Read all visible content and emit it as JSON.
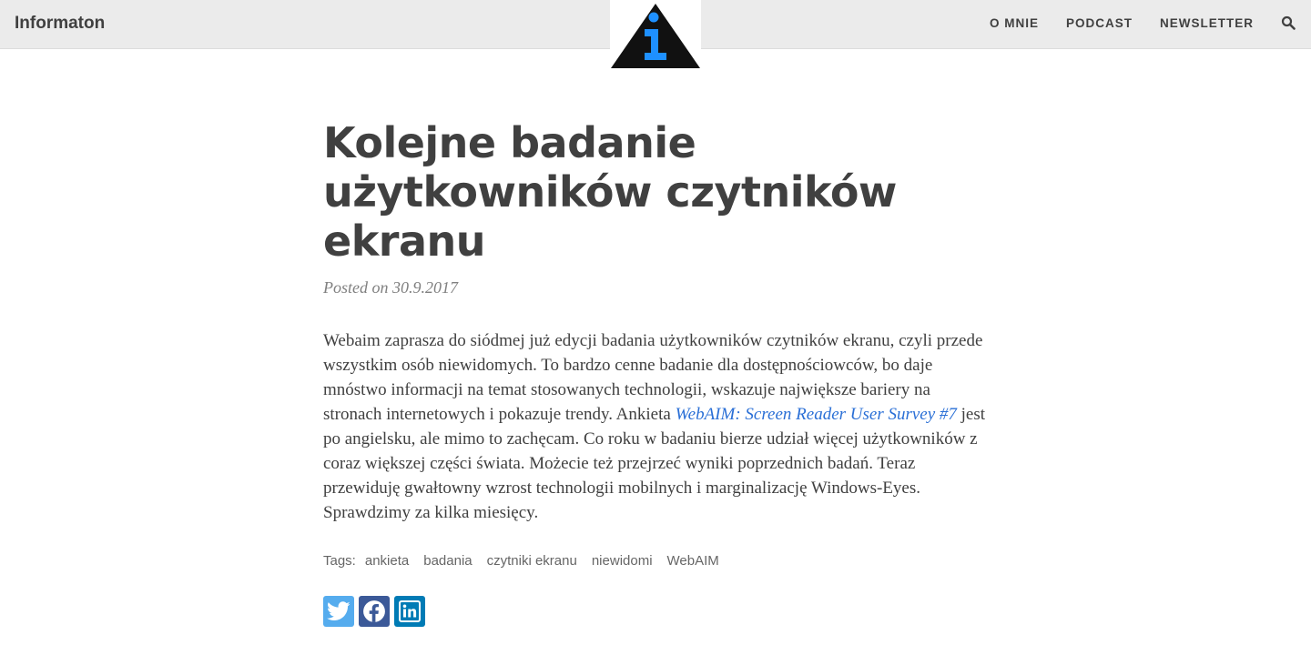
{
  "navbar": {
    "brand": "Informaton",
    "links": [
      "O MNIE",
      "PODCAST",
      "NEWSLETTER"
    ],
    "search_icon": "search-icon"
  },
  "logo": {
    "icon": "info-triangle-icon",
    "colors": {
      "triangle": "#111111",
      "info": "#1e90ff"
    }
  },
  "post": {
    "title": "Kolejne badanie użytkowników czytników ekranu",
    "meta": "Posted on 30.9.2017",
    "body_part1": "Webaim zaprasza do siódmej już edycji badania użytkowników czytników ekranu, czyli przede wszystkim osób niewidomych. To bardzo cenne badanie dla dostępnościowców, bo daje mnóstwo informacji na temat stosowanych technologii, wskazuje największe bariery na stronach internetowych i pokazuje trendy. Ankieta ",
    "link_text": "WebAIM: Screen Reader User Survey #7",
    "body_part2": " jest po angielsku, ale mimo to zachęcam. Co roku w badaniu bierze udział więcej użytkowników z coraz większej części świata. Możecie też przejrzeć wyniki poprzednich badań. Teraz przewiduję gwałtowny wzrost technologii mobilnych i marginalizację Windows-Eyes. Sprawdzimy za kilka miesięcy."
  },
  "tags": {
    "label": "Tags:",
    "items": [
      "ankieta",
      "badania",
      "czytniki ekranu",
      "niewidomi",
      "WebAIM"
    ]
  },
  "share": {
    "buttons": [
      {
        "icon": "twitter-icon",
        "color": "#55acee"
      },
      {
        "icon": "facebook-icon",
        "color": "#3b5998"
      },
      {
        "icon": "linkedin-icon",
        "color": "#007bb5"
      }
    ]
  },
  "colors": {
    "link": "#2a6fd6",
    "text": "#404040",
    "navbar_bg": "#ebebeb"
  }
}
